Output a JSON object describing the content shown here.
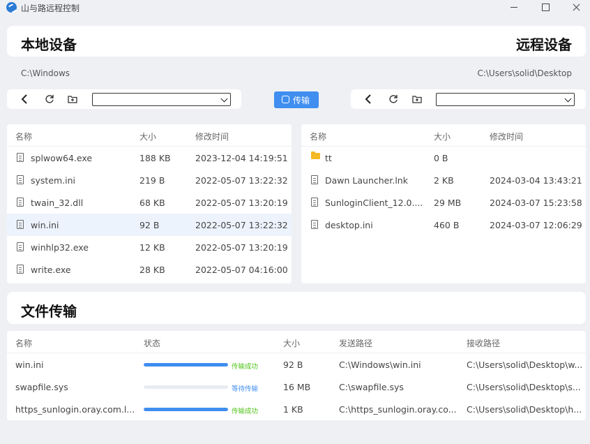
{
  "window": {
    "title": "山与路远程控制"
  },
  "header": {
    "local_title": "本地设备",
    "remote_title": "远程设备"
  },
  "paths": {
    "local": "C:\\Windows",
    "remote": "C:\\Users\\solid\\Desktop"
  },
  "toolbar": {
    "transfer_label": "传输",
    "local_drive": "",
    "remote_drive": ""
  },
  "file_columns": {
    "name": "名称",
    "size": "大小",
    "mtime": "修改时间"
  },
  "local_files": [
    {
      "name": "splwow64.exe",
      "size": "188 KB",
      "mtime": "2023-12-04 14:19:51",
      "icon": "file-icon"
    },
    {
      "name": "system.ini",
      "size": "219 B",
      "mtime": "2022-05-07 13:22:32",
      "icon": "file-icon"
    },
    {
      "name": "twain_32.dll",
      "size": "68 KB",
      "mtime": "2022-05-07 13:20:19",
      "icon": "file-icon"
    },
    {
      "name": "win.ini",
      "size": "92 B",
      "mtime": "2022-05-07 13:22:32",
      "icon": "file-icon",
      "selected": true
    },
    {
      "name": "winhlp32.exe",
      "size": "12 KB",
      "mtime": "2022-05-07 13:20:19",
      "icon": "file-icon"
    },
    {
      "name": "write.exe",
      "size": "28 KB",
      "mtime": "2022-05-07 04:16:00",
      "icon": "file-icon"
    }
  ],
  "remote_files": [
    {
      "name": "tt",
      "size": "0 B",
      "mtime": "",
      "icon": "folder-icon"
    },
    {
      "name": "Dawn Launcher.lnk",
      "size": "2 KB",
      "mtime": "2024-03-04 13:43:21",
      "icon": "file-icon"
    },
    {
      "name": "SunloginClient_12.0....",
      "size": "29 MB",
      "mtime": "2024-03-07 15:23:58",
      "icon": "file-icon"
    },
    {
      "name": "desktop.ini",
      "size": "460 B",
      "mtime": "2024-03-07 12:06:29",
      "icon": "file-icon"
    }
  ],
  "transfer": {
    "title": "文件传输",
    "columns": {
      "name": "名称",
      "status": "状态",
      "size": "大小",
      "src": "发送路径",
      "dst": "接收路径"
    },
    "rows": [
      {
        "name": "win.ini",
        "progress": 1.0,
        "status": "传输成功",
        "status_color": "#52c41a",
        "size": "92 B",
        "src": "C:\\Windows\\win.ini",
        "dst": "C:\\Users\\solid\\Desktop\\w..."
      },
      {
        "name": "swapfile.sys",
        "progress": 0.0,
        "status": "等待传输",
        "status_color": "#3f8ef0",
        "size": "16 MB",
        "src": "C:\\swapfile.sys",
        "dst": "C:\\Users\\solid\\Desktop\\s..."
      },
      {
        "name": "https_sunlogin.oray.com.l...",
        "progress": 1.0,
        "status": "传输成功",
        "status_color": "#52c41a",
        "size": "1 KB",
        "src": "C:\\https_sunlogin.oray.co...",
        "dst": "C:\\Users\\solid\\Desktop\\h..."
      }
    ]
  },
  "colors": {
    "accent": "#3f8ef0",
    "success": "#52c41a",
    "folder": "#f6b926",
    "selected_row": "#edf3fd"
  }
}
